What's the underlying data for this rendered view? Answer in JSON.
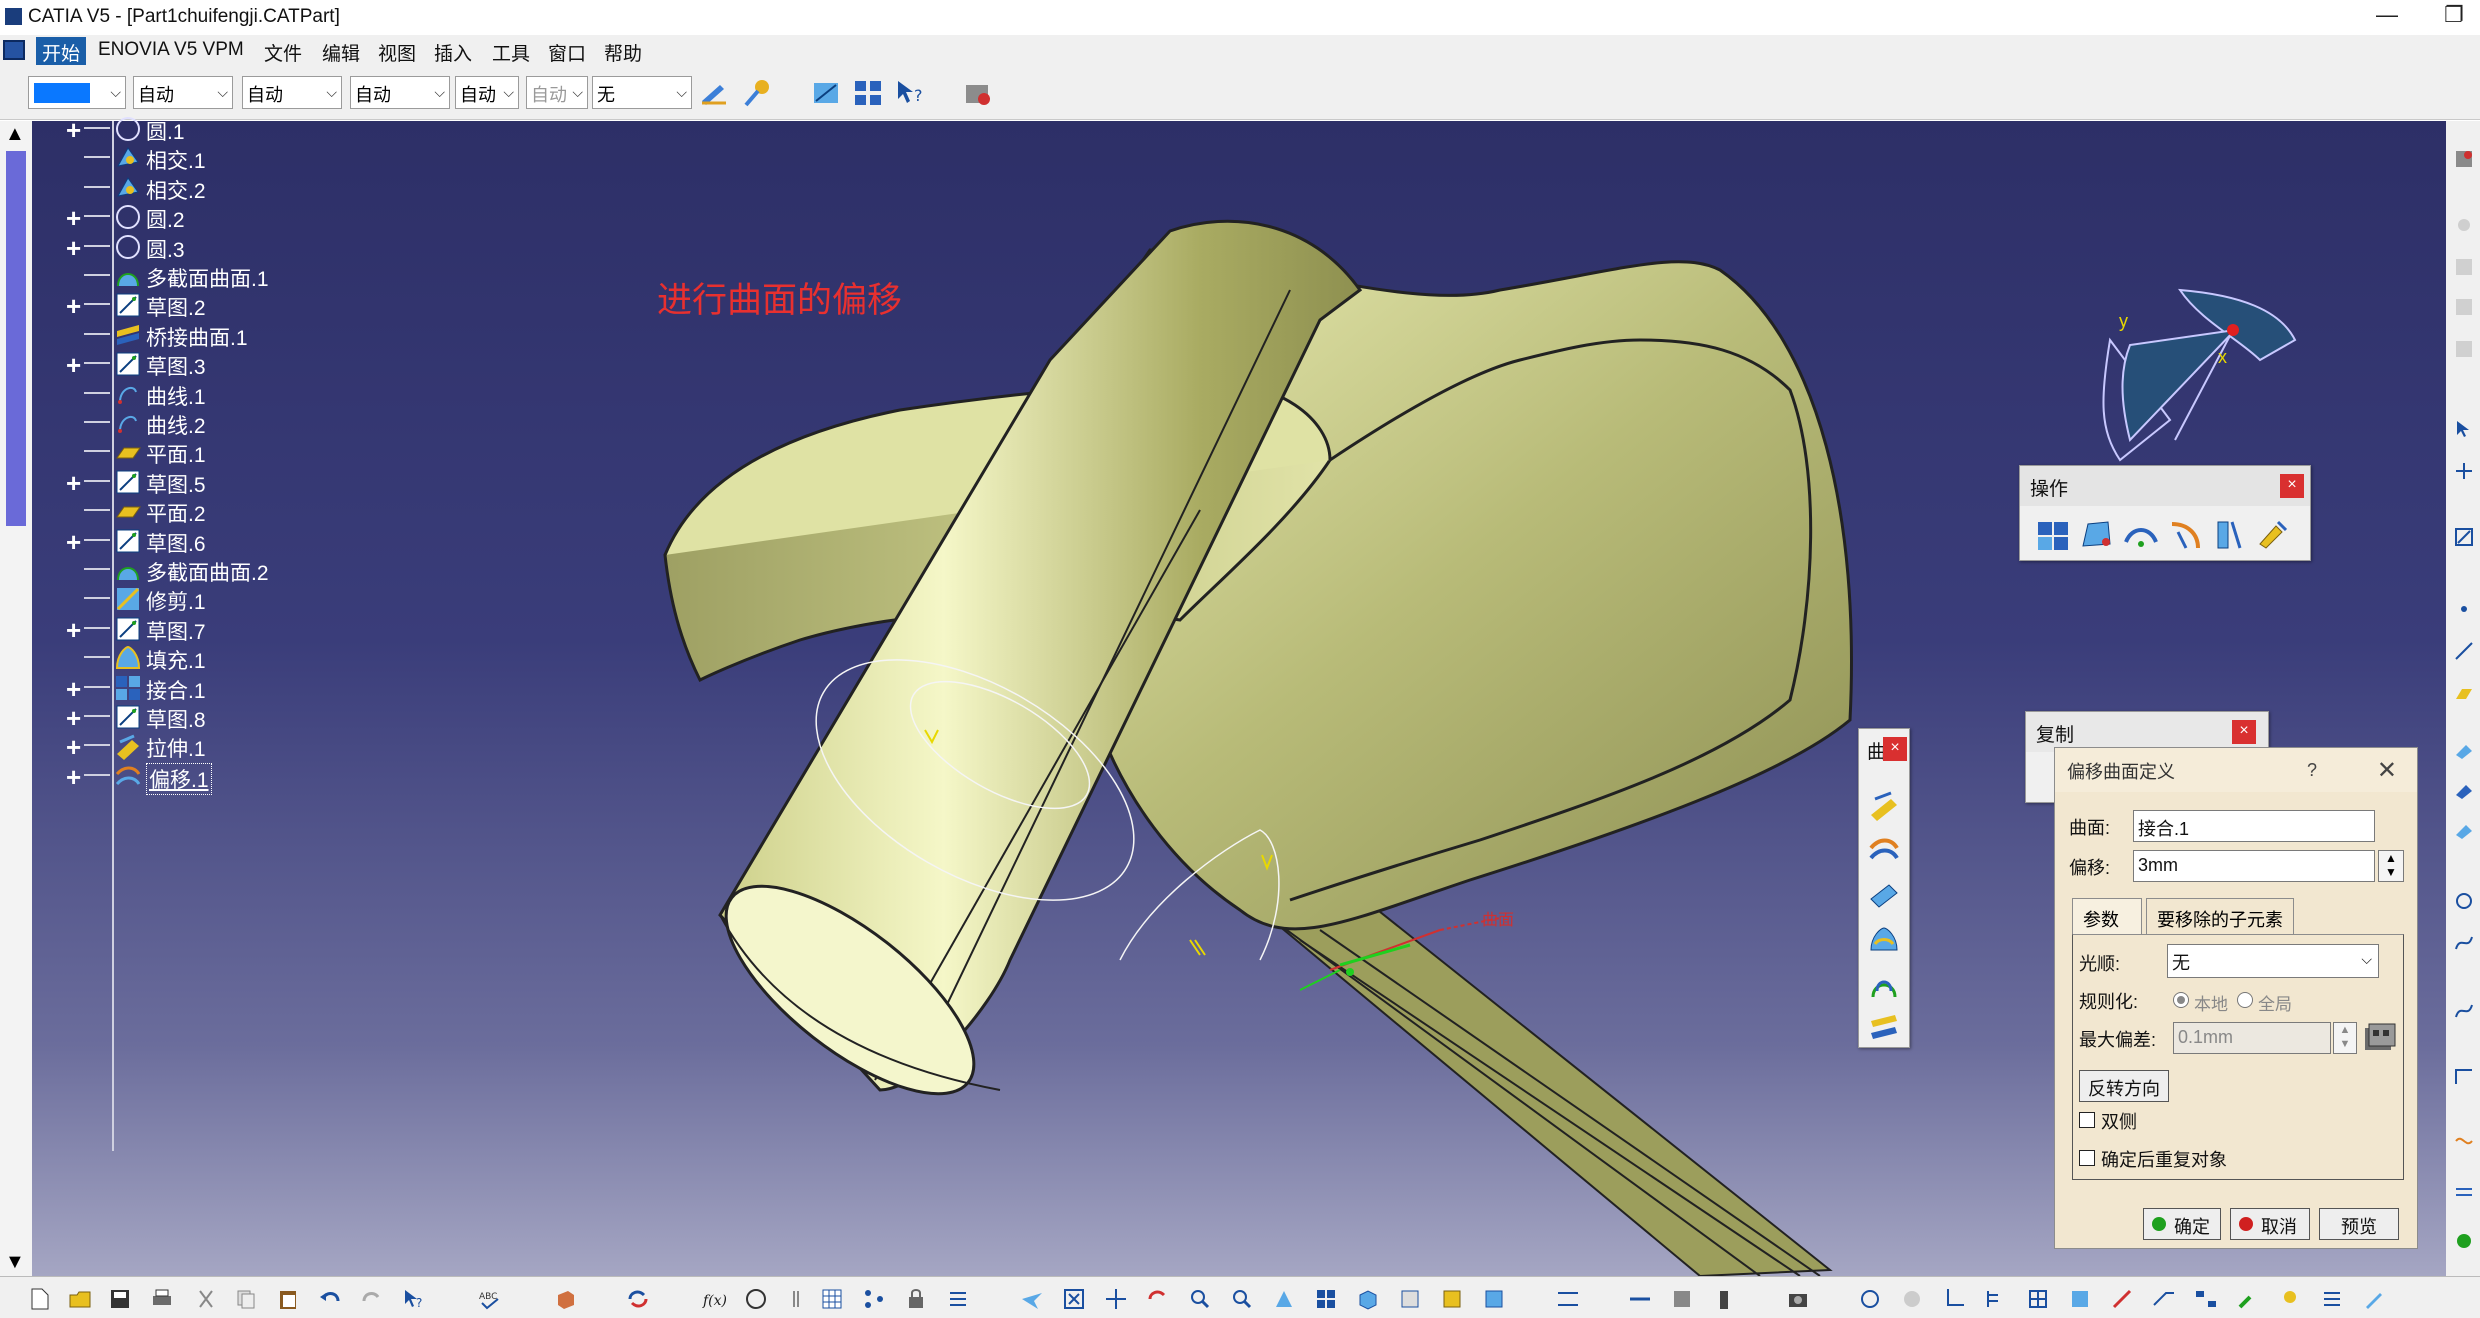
{
  "window": {
    "title": "CATIA V5 - [Part1chuifengji.CATPart]",
    "minimize_glyph": "—",
    "restore_glyph": "❐"
  },
  "menu": {
    "items": [
      "开始",
      "ENOVIA V5 VPM",
      "文件",
      "编辑",
      "视图",
      "插入",
      "工具",
      "窗口",
      "帮助"
    ]
  },
  "toolbar": {
    "color_select": "",
    "linetype_select": "自动",
    "thickness_select": "自动",
    "layer_select": "自动",
    "style_select": "自动",
    "grey_select": "自动",
    "none_select": "无"
  },
  "tree": {
    "items": [
      {
        "label": "圆.1",
        "plus": true,
        "icon": "circle-icon"
      },
      {
        "label": "相交.1",
        "plus": false,
        "icon": "intersect-icon"
      },
      {
        "label": "相交.2",
        "plus": false,
        "icon": "intersect-icon"
      },
      {
        "label": "圆.2",
        "plus": true,
        "icon": "circle-icon"
      },
      {
        "label": "圆.3",
        "plus": true,
        "icon": "circle-icon"
      },
      {
        "label": "多截面曲面.1",
        "plus": false,
        "icon": "multisection-surface-icon"
      },
      {
        "label": "草图.2",
        "plus": true,
        "icon": "sketch-icon"
      },
      {
        "label": "桥接曲面.1",
        "plus": false,
        "icon": "blend-surface-icon"
      },
      {
        "label": "草图.3",
        "plus": true,
        "icon": "sketch-icon"
      },
      {
        "label": "曲线.1",
        "plus": false,
        "icon": "curve-icon"
      },
      {
        "label": "曲线.2",
        "plus": false,
        "icon": "curve-icon"
      },
      {
        "label": "平面.1",
        "plus": false,
        "icon": "plane-icon"
      },
      {
        "label": "草图.5",
        "plus": true,
        "icon": "sketch-icon"
      },
      {
        "label": "平面.2",
        "plus": false,
        "icon": "plane-icon"
      },
      {
        "label": "草图.6",
        "plus": true,
        "icon": "sketch-icon"
      },
      {
        "label": "多截面曲面.2",
        "plus": false,
        "icon": "multisection-surface-icon"
      },
      {
        "label": "修剪.1",
        "plus": false,
        "icon": "trim-icon"
      },
      {
        "label": "草图.7",
        "plus": true,
        "icon": "sketch-icon"
      },
      {
        "label": "填充.1",
        "plus": false,
        "icon": "fill-icon"
      },
      {
        "label": "接合.1",
        "plus": true,
        "icon": "join-icon"
      },
      {
        "label": "草图.8",
        "plus": true,
        "icon": "sketch-icon"
      },
      {
        "label": "拉伸.1",
        "plus": true,
        "icon": "extrude-icon"
      },
      {
        "label": "偏移.1",
        "plus": true,
        "icon": "offset-icon"
      }
    ]
  },
  "annotation": "进行曲面的偏移",
  "compass": {
    "x_label": "x",
    "y_label": "y"
  },
  "panels": {
    "operations_title": "操作",
    "copy_title": "复制",
    "surfaces_title": "曲"
  },
  "close_glyph": "×",
  "dialog": {
    "title": "偏移曲面定义",
    "help_glyph": "?",
    "close_glyph": "✕",
    "surface_label": "曲面:",
    "surface_value": "接合.1",
    "offset_label": "偏移:",
    "offset_value": "3mm",
    "tab_params": "参数",
    "tab_remove": "要移除的子元素",
    "smooth_label": "光顺:",
    "smooth_value": "无",
    "regularize_label": "规则化:",
    "regularize_local": "本地",
    "regularize_global": "全局",
    "max_dev_label": "最大偏差:",
    "max_dev_value": "0.1mm",
    "reverse_button": "反转方向",
    "both_sides": "双侧",
    "repeat_after_ok": "确定后重复对象",
    "ok": "确定",
    "cancel": "取消",
    "preview": "预览"
  },
  "colors": {
    "viewport_top": "#2d2f67",
    "model_fill": "#e2e5a6",
    "annotation": "#e8302f",
    "active_menu": "#1a5ea8"
  }
}
